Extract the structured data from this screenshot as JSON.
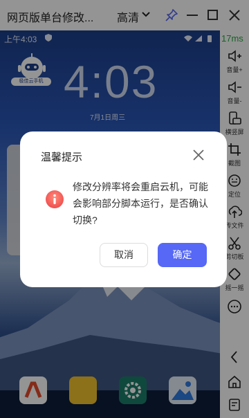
{
  "titlebar": {
    "title": "网页版单台修改...",
    "quality": "高清"
  },
  "statusbar": {
    "time": "上午4:03"
  },
  "lockscreen": {
    "robot_label": "极佳云手机",
    "clock": "4:03",
    "date": "7月1日周三"
  },
  "latency": "17ms",
  "sidebar": {
    "items": [
      {
        "label": "音量+",
        "icon": "volume-up-icon"
      },
      {
        "label": "音量-",
        "icon": "volume-down-icon"
      },
      {
        "label": "横竖屏",
        "icon": "rotate-screen-icon"
      },
      {
        "label": "截图",
        "icon": "crop-icon"
      },
      {
        "label": "定位",
        "icon": "location-icon"
      },
      {
        "label": "传文件",
        "icon": "upload-icon"
      },
      {
        "label": "剪切板",
        "icon": "scissors-icon"
      },
      {
        "label": "摇一摇",
        "icon": "shake-icon"
      },
      {
        "label": "",
        "icon": "more-icon"
      },
      {
        "label": "",
        "icon": "back-icon"
      },
      {
        "label": "",
        "icon": "home-icon"
      },
      {
        "label": "",
        "icon": "recent-apps-icon"
      }
    ]
  },
  "dialog": {
    "title": "温馨提示",
    "message": "修改分辨率将会重启云机，可能会影响部分脚本运行，是否确认切换?",
    "cancel": "取消",
    "confirm": "确定"
  },
  "colors": {
    "accent": "#5668f5",
    "latency": "#2aa640",
    "info": "#f04e4e"
  }
}
